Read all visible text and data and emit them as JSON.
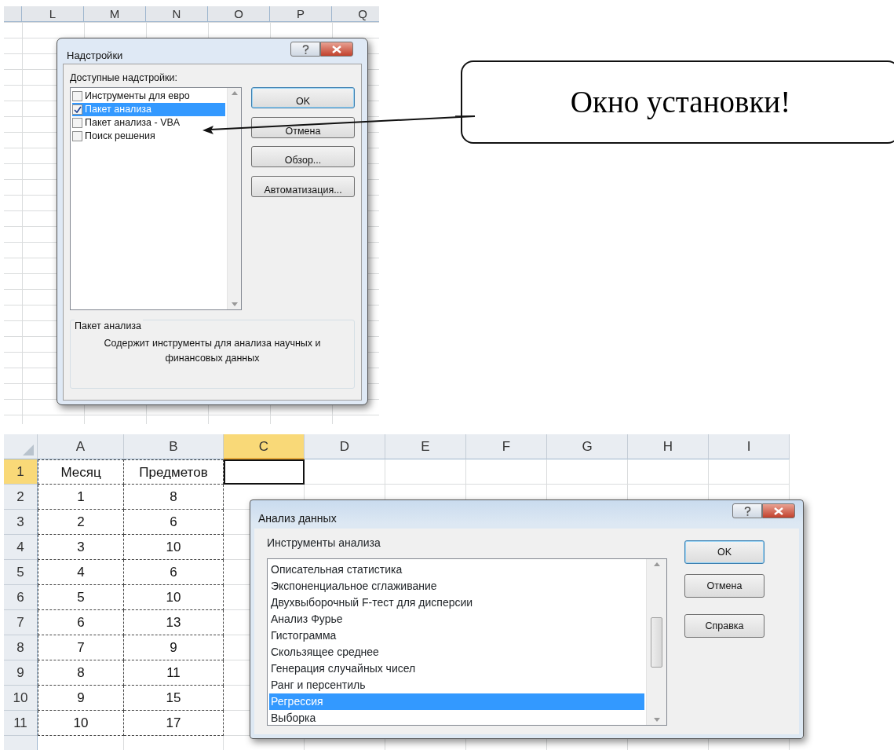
{
  "top_sheet": {
    "column_headers": [
      "L",
      "M",
      "N",
      "O",
      "P",
      "Q"
    ]
  },
  "addins_dialog": {
    "title": "Надстройки",
    "list_label": "Доступные надстройки:",
    "items": [
      {
        "label": "Инструменты для евро",
        "checked": false,
        "selected": false
      },
      {
        "label": "Пакет анализа",
        "checked": true,
        "selected": true
      },
      {
        "label": "Пакет анализа - VBA",
        "checked": false,
        "selected": false
      },
      {
        "label": "Поиск решения",
        "checked": false,
        "selected": false
      }
    ],
    "buttons": [
      {
        "label": "OK",
        "default": true
      },
      {
        "label": "Отмена",
        "default": false
      },
      {
        "label": "Обзор...",
        "default": false
      },
      {
        "label": "Автоматизация...",
        "default": false
      }
    ],
    "description": {
      "group_label": "Пакет анализа",
      "text": "Содержит инструменты для анализа научных и финансовых данных"
    }
  },
  "callout": {
    "text": "Окно установки!"
  },
  "bottom_sheet": {
    "column_headers": [
      {
        "label": "A",
        "selected": false
      },
      {
        "label": "B",
        "selected": false
      },
      {
        "label": "C",
        "selected": true
      },
      {
        "label": "D",
        "selected": false
      },
      {
        "label": "E",
        "selected": false
      },
      {
        "label": "F",
        "selected": false
      },
      {
        "label": "G",
        "selected": false
      },
      {
        "label": "H",
        "selected": false
      },
      {
        "label": "I",
        "selected": false
      }
    ],
    "rows": [
      {
        "number": "1",
        "selected": true,
        "cells": [
          "Месяц",
          "Предметов"
        ]
      },
      {
        "number": "2",
        "selected": false,
        "cells": [
          "1",
          "8"
        ]
      },
      {
        "number": "3",
        "selected": false,
        "cells": [
          "2",
          "6"
        ]
      },
      {
        "number": "4",
        "selected": false,
        "cells": [
          "3",
          "10"
        ]
      },
      {
        "number": "5",
        "selected": false,
        "cells": [
          "4",
          "6"
        ]
      },
      {
        "number": "6",
        "selected": false,
        "cells": [
          "5",
          "10"
        ]
      },
      {
        "number": "7",
        "selected": false,
        "cells": [
          "6",
          "13"
        ]
      },
      {
        "number": "8",
        "selected": false,
        "cells": [
          "7",
          "9"
        ]
      },
      {
        "number": "9",
        "selected": false,
        "cells": [
          "8",
          "11"
        ]
      },
      {
        "number": "10",
        "selected": false,
        "cells": [
          "9",
          "15"
        ]
      },
      {
        "number": "11",
        "selected": false,
        "cells": [
          "10",
          "17"
        ]
      }
    ]
  },
  "analysis_dialog": {
    "title": "Анализ данных",
    "list_label": "Инструменты анализа",
    "items": [
      {
        "label": "Описательная статистика",
        "selected": false
      },
      {
        "label": "Экспоненциальное сглаживание",
        "selected": false
      },
      {
        "label": "Двухвыборочный F-тест для дисперсии",
        "selected": false
      },
      {
        "label": "Анализ Фурье",
        "selected": false
      },
      {
        "label": "Гистограмма",
        "selected": false
      },
      {
        "label": "Скользящее среднее",
        "selected": false
      },
      {
        "label": "Генерация случайных чисел",
        "selected": false
      },
      {
        "label": "Ранг и персентиль",
        "selected": false
      },
      {
        "label": "Регрессия",
        "selected": true
      },
      {
        "label": "Выборка",
        "selected": false
      }
    ],
    "buttons": [
      {
        "label": "OK",
        "default": true
      },
      {
        "label": "Отмена",
        "default": false
      },
      {
        "label": "Справка",
        "default": false
      }
    ]
  }
}
